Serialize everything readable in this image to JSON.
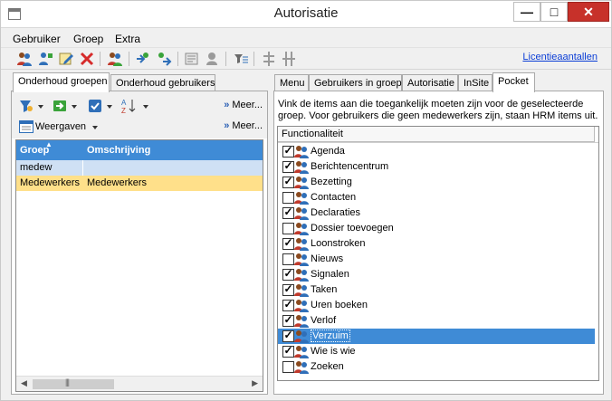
{
  "window": {
    "title": "Autorisatie",
    "buttons": {
      "minimize": "—",
      "maximize": "□",
      "close": "✕"
    }
  },
  "menubar": [
    "Gebruiker",
    "Groep",
    "Extra"
  ],
  "toolbar": {
    "license_link": "Licentieaantallen"
  },
  "left_tabs": [
    "Onderhoud groepen",
    "Onderhoud gebruikers"
  ],
  "left_toolbar": {
    "more_label_1": "Meer...",
    "more_label_2": "Meer...",
    "views_label": "Weergaven"
  },
  "grid": {
    "columns": [
      "Groep",
      "Omschrijving"
    ],
    "rows": [
      {
        "group": "medew",
        "description": "",
        "state": "edit"
      },
      {
        "group": "Medewerkers",
        "description": "Medewerkers",
        "state": "highlight"
      }
    ]
  },
  "right_tabs": [
    "Menu",
    "Gebruikers in groep",
    "Autorisatie",
    "InSite",
    "Pocket"
  ],
  "right_active_tab": "Pocket",
  "info_text": "Vink de items aan die toegankelijk moeten zijn voor de geselecteerde groep. Voor gebruikers die geen medewerkers zijn, staan HRM items uit.",
  "functionality": {
    "header": "Functionaliteit",
    "items": [
      {
        "label": "Agenda",
        "checked": true
      },
      {
        "label": "Berichtencentrum",
        "checked": true
      },
      {
        "label": "Bezetting",
        "checked": true
      },
      {
        "label": "Contacten",
        "checked": false
      },
      {
        "label": "Declaraties",
        "checked": true
      },
      {
        "label": "Dossier toevoegen",
        "checked": false
      },
      {
        "label": "Loonstroken",
        "checked": true
      },
      {
        "label": "Nieuws",
        "checked": false
      },
      {
        "label": "Signalen",
        "checked": true
      },
      {
        "label": "Taken",
        "checked": true
      },
      {
        "label": "Uren boeken",
        "checked": true
      },
      {
        "label": "Verlof",
        "checked": true
      },
      {
        "label": "Verzuim",
        "checked": true,
        "selected": true
      },
      {
        "label": "Wie is wie",
        "checked": true
      },
      {
        "label": "Zoeken",
        "checked": false
      }
    ]
  },
  "colors": {
    "accent": "#3f8bd6",
    "row_highlight": "#ffe08a",
    "row_edit": "#cfe0f4",
    "close_button": "#c7312a",
    "link": "#0a3dd6"
  },
  "icons": {
    "toolbar": [
      "users-group-icon",
      "user-add-icon",
      "edit-icon",
      "delete-icon",
      "users-copy-icon",
      "import-icon",
      "export-icon",
      "report-icon",
      "puzzle-icon",
      "filter-icon",
      "align-icon",
      "align-alt-icon"
    ],
    "item_icon": "users-group-icon"
  }
}
